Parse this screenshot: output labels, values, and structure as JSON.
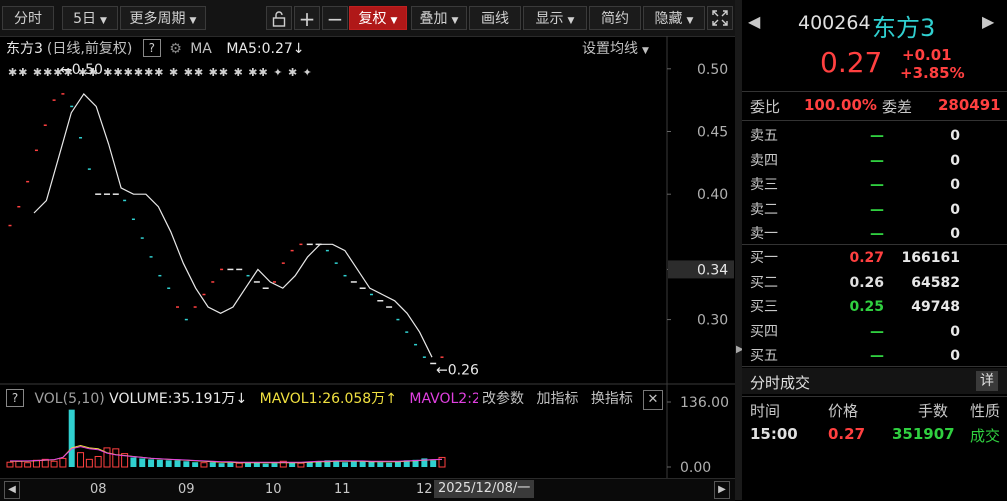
{
  "toolbar": {
    "fenshi": "分时",
    "period": "5日",
    "more_period": "更多周期",
    "fuquan": "复权",
    "diejia": "叠加",
    "huaxian": "画线",
    "xianshi": "显示",
    "jianyue": "简约",
    "yincang": "隐藏",
    "expand_icon": "expand-icon"
  },
  "chart_header": {
    "title": "东方3",
    "subtitle": "(日线,前复权)",
    "help": "?",
    "ma_label": "MA",
    "ma5": "MA5:0.27",
    "ma_arrow": "↓",
    "setting": "设置均线"
  },
  "annotations": {
    "high": "0.50",
    "low": "0.26"
  },
  "price_axis": [
    "0.50",
    "0.45",
    "0.40",
    "0.34",
    "0.30"
  ],
  "volume_header": {
    "help": "?",
    "vol": "VOL(5,10)",
    "volume": "VOLUME:35.191万",
    "volume_arrow": "↓",
    "mavol1": "MAVOL1:26.058万",
    "mavol1_arrow": "↑",
    "mavol2": "MAVOL2:2",
    "change_params": "改参数",
    "add_indicator": "加指标",
    "switch_indicator": "换指标"
  },
  "volume_axis": [
    "136.00",
    "0.00"
  ],
  "date_axis": [
    "08",
    "09",
    "10",
    "11",
    "12"
  ],
  "date_cursor": "2025/12/08/一",
  "panel": {
    "code": "400264",
    "name": "东方3",
    "price": "0.27",
    "change": "+0.01",
    "change_pct": "+3.85%",
    "weibi_label": "委比",
    "weibi_value": "100.00%",
    "weicha_label": "委差",
    "weicha_value": "280491",
    "asks": [
      {
        "label": "卖五",
        "price": "—",
        "vol": "0"
      },
      {
        "label": "卖四",
        "price": "—",
        "vol": "0"
      },
      {
        "label": "卖三",
        "price": "—",
        "vol": "0"
      },
      {
        "label": "卖二",
        "price": "—",
        "vol": "0"
      },
      {
        "label": "卖一",
        "price": "—",
        "vol": "0"
      }
    ],
    "bids": [
      {
        "label": "买一",
        "price": "0.27",
        "vol": "166161",
        "color": "#ff4040"
      },
      {
        "label": "买二",
        "price": "0.26",
        "vol": "64582",
        "color": "#e0e0e0"
      },
      {
        "label": "买三",
        "price": "0.25",
        "vol": "49748",
        "color": "#30d040"
      },
      {
        "label": "买四",
        "price": "—",
        "vol": "0",
        "color": "#30d040"
      },
      {
        "label": "买五",
        "price": "—",
        "vol": "0",
        "color": "#30d040"
      }
    ],
    "trades_title": "分时成交",
    "trades_detail": "详",
    "trade_headers": [
      "时间",
      "价格",
      "手数",
      "性质"
    ],
    "trade": {
      "time": "15:00",
      "price": "0.27",
      "qty": "351907",
      "nature": "成交"
    }
  },
  "colors": {
    "up": "#ff4040",
    "down": "#30d0d0",
    "flat": "#e8e8e8",
    "green": "#30d040",
    "ma_line": "#e8e8e8",
    "mavol1": "#f0e040",
    "mavol2": "#e040e0"
  },
  "chart_data": {
    "type": "line",
    "price_range": [
      0.255,
      0.515
    ],
    "price_ticks": [
      0.5,
      0.45,
      0.4,
      0.34,
      0.3
    ],
    "ma5": [
      0.385,
      0.395,
      0.43,
      0.465,
      0.48,
      0.47,
      0.44,
      0.405,
      0.4,
      0.4,
      0.39,
      0.37,
      0.345,
      0.325,
      0.31,
      0.305,
      0.31,
      0.325,
      0.34,
      0.33,
      0.325,
      0.335,
      0.35,
      0.36,
      0.36,
      0.355,
      0.34,
      0.325,
      0.32,
      0.315,
      0.305,
      0.29,
      0.27
    ],
    "bars": [
      {
        "v": 0.375,
        "c": "up"
      },
      {
        "v": 0.39,
        "c": "up"
      },
      {
        "v": 0.41,
        "c": "up"
      },
      {
        "v": 0.435,
        "c": "up"
      },
      {
        "v": 0.455,
        "c": "up"
      },
      {
        "v": 0.475,
        "c": "up"
      },
      {
        "v": 0.48,
        "c": "up"
      },
      {
        "v": 0.47,
        "c": "down"
      },
      {
        "v": 0.445,
        "c": "down"
      },
      {
        "v": 0.42,
        "c": "down"
      },
      {
        "v": 0.4,
        "c": "flat"
      },
      {
        "v": 0.4,
        "c": "flat"
      },
      {
        "v": 0.4,
        "c": "flat"
      },
      {
        "v": 0.395,
        "c": "down"
      },
      {
        "v": 0.38,
        "c": "down"
      },
      {
        "v": 0.365,
        "c": "down"
      },
      {
        "v": 0.35,
        "c": "down"
      },
      {
        "v": 0.335,
        "c": "down"
      },
      {
        "v": 0.325,
        "c": "down"
      },
      {
        "v": 0.31,
        "c": "up"
      },
      {
        "v": 0.3,
        "c": "down"
      },
      {
        "v": 0.31,
        "c": "up"
      },
      {
        "v": 0.32,
        "c": "up"
      },
      {
        "v": 0.33,
        "c": "up"
      },
      {
        "v": 0.34,
        "c": "up"
      },
      {
        "v": 0.34,
        "c": "flat"
      },
      {
        "v": 0.34,
        "c": "flat"
      },
      {
        "v": 0.335,
        "c": "down"
      },
      {
        "v": 0.33,
        "c": "flat"
      },
      {
        "v": 0.325,
        "c": "flat"
      },
      {
        "v": 0.33,
        "c": "up"
      },
      {
        "v": 0.345,
        "c": "up"
      },
      {
        "v": 0.355,
        "c": "up"
      },
      {
        "v": 0.36,
        "c": "up"
      },
      {
        "v": 0.36,
        "c": "flat"
      },
      {
        "v": 0.36,
        "c": "flat"
      },
      {
        "v": 0.355,
        "c": "down"
      },
      {
        "v": 0.345,
        "c": "down"
      },
      {
        "v": 0.335,
        "c": "down"
      },
      {
        "v": 0.33,
        "c": "flat"
      },
      {
        "v": 0.325,
        "c": "flat"
      },
      {
        "v": 0.32,
        "c": "down"
      },
      {
        "v": 0.315,
        "c": "flat"
      },
      {
        "v": 0.31,
        "c": "flat"
      },
      {
        "v": 0.3,
        "c": "down"
      },
      {
        "v": 0.29,
        "c": "down"
      },
      {
        "v": 0.28,
        "c": "down"
      },
      {
        "v": 0.27,
        "c": "down"
      },
      {
        "v": 0.265,
        "c": "flat"
      },
      {
        "v": 0.27,
        "c": "up"
      }
    ],
    "volume_range": [
      0,
      136
    ],
    "volume_ticks": [
      136.0,
      0.0
    ],
    "volume": [
      {
        "v": 10,
        "c": "up"
      },
      {
        "v": 12,
        "c": "up"
      },
      {
        "v": 9,
        "c": "up"
      },
      {
        "v": 14,
        "c": "up"
      },
      {
        "v": 16,
        "c": "up"
      },
      {
        "v": 12,
        "c": "up"
      },
      {
        "v": 18,
        "c": "up"
      },
      {
        "v": 120,
        "c": "down"
      },
      {
        "v": 30,
        "c": "up"
      },
      {
        "v": 16,
        "c": "up"
      },
      {
        "v": 22,
        "c": "up"
      },
      {
        "v": 40,
        "c": "up"
      },
      {
        "v": 38,
        "c": "up"
      },
      {
        "v": 28,
        "c": "up"
      },
      {
        "v": 20,
        "c": "down"
      },
      {
        "v": 18,
        "c": "down"
      },
      {
        "v": 16,
        "c": "down"
      },
      {
        "v": 15,
        "c": "down"
      },
      {
        "v": 14,
        "c": "down"
      },
      {
        "v": 14,
        "c": "down"
      },
      {
        "v": 12,
        "c": "down"
      },
      {
        "v": 10,
        "c": "down"
      },
      {
        "v": 9,
        "c": "up"
      },
      {
        "v": 10,
        "c": "down"
      },
      {
        "v": 8,
        "c": "down"
      },
      {
        "v": 9,
        "c": "down"
      },
      {
        "v": 8,
        "c": "up"
      },
      {
        "v": 10,
        "c": "down"
      },
      {
        "v": 9,
        "c": "down"
      },
      {
        "v": 7,
        "c": "down"
      },
      {
        "v": 8,
        "c": "down"
      },
      {
        "v": 12,
        "c": "up"
      },
      {
        "v": 9,
        "c": "down"
      },
      {
        "v": 8,
        "c": "up"
      },
      {
        "v": 10,
        "c": "down"
      },
      {
        "v": 11,
        "c": "down"
      },
      {
        "v": 14,
        "c": "down"
      },
      {
        "v": 12,
        "c": "down"
      },
      {
        "v": 10,
        "c": "down"
      },
      {
        "v": 13,
        "c": "down"
      },
      {
        "v": 12,
        "c": "down"
      },
      {
        "v": 11,
        "c": "down"
      },
      {
        "v": 10,
        "c": "down"
      },
      {
        "v": 9,
        "c": "down"
      },
      {
        "v": 12,
        "c": "down"
      },
      {
        "v": 14,
        "c": "down"
      },
      {
        "v": 15,
        "c": "down"
      },
      {
        "v": 18,
        "c": "down"
      },
      {
        "v": 14,
        "c": "down"
      },
      {
        "v": 20,
        "c": "up"
      }
    ],
    "mavol1": [
      12,
      12,
      12,
      13,
      14,
      15,
      20,
      40,
      45,
      40,
      38,
      30,
      26,
      24,
      22,
      20,
      18,
      17,
      16,
      15,
      14,
      13,
      12,
      11,
      10,
      10,
      9,
      9,
      9,
      9,
      9,
      9,
      9,
      9,
      10,
      11,
      11,
      12,
      12,
      12,
      12,
      11,
      11,
      11,
      11,
      12,
      13,
      14,
      15,
      16
    ]
  }
}
